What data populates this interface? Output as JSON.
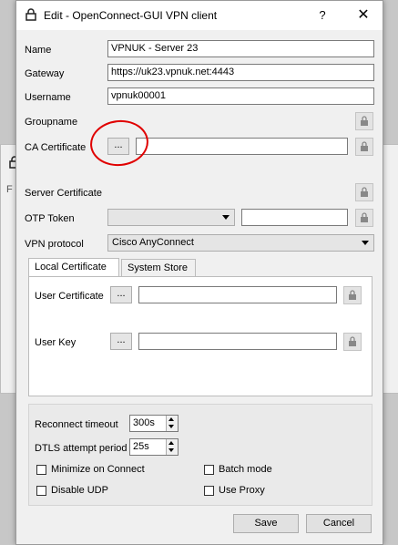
{
  "background_window": {
    "partial_text": "F"
  },
  "window": {
    "title": "Edit - OpenConnect-GUI VPN client",
    "help": "?",
    "close": "✕"
  },
  "form": {
    "name_label": "Name",
    "name_value": "VPNUK - Server 23",
    "gateway_label": "Gateway",
    "gateway_value": "https://uk23.vpnuk.net:4443",
    "username_label": "Username",
    "username_value": "vpnuk00001",
    "groupname_label": "Groupname",
    "ca_label": "CA Certificate",
    "browse": "...",
    "server_cert_label": "Server Certificate",
    "otp_label": "OTP Token",
    "protocol_label": "VPN protocol",
    "protocol_value": "Cisco AnyConnect"
  },
  "tabs": [
    {
      "label": "Local Certificate"
    },
    {
      "label": "System Store"
    }
  ],
  "local_cert": {
    "user_cert_label": "User Certificate",
    "user_key_label": "User Key",
    "browse": "..."
  },
  "options": {
    "reconnect_label": "Reconnect timeout",
    "reconnect_value": "300s",
    "dtls_label": "DTLS attempt period",
    "dtls_value": "25s",
    "minimize_label": "Minimize on Connect",
    "minimize_checked": false,
    "batch_label": "Batch mode",
    "batch_checked": false,
    "disable_udp_label": "Disable UDP",
    "disable_udp_checked": false,
    "proxy_label": "Use Proxy",
    "proxy_checked": false
  },
  "buttons": {
    "save": "Save",
    "cancel": "Cancel"
  },
  "annotation": {
    "highlight_color": "#e00000"
  }
}
